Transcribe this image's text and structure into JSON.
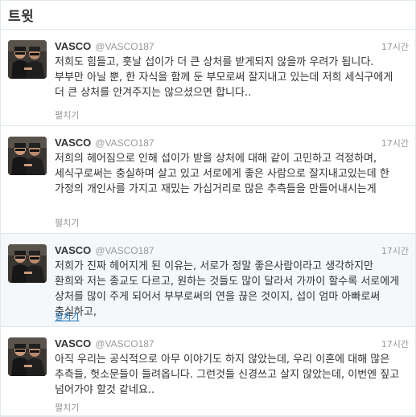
{
  "header": {
    "title": "트윗"
  },
  "tweets": [
    {
      "name": "VASCO",
      "handle": "@VASCO187",
      "time": "17시간",
      "text": "저희도 힘들고, 훗날 섭이가 더 큰 상처를 받게되지 않을까 우려가 됩니다. 부부만 아닐 뿐, 한 자식을 함께 둔 부모로써 잘지내고 있는데 저희 세식구에게 더 큰 상처를 안겨주지는 않으셨으면 합니다..",
      "expand": "펼치기"
    },
    {
      "name": "VASCO",
      "handle": "@VASCO187",
      "time": "17시간",
      "text": "저희의 헤어짐으로 인해 섭이가 받을 상처에 대해 같이 고민하고 걱정하며, 세식구로써는 충실하며 살고 있고 서로에게 좋은 사람으로 잘지내고있는데 한 가정의 개인사를 가지고 재밌는 가십거리로 많은 추측들을 만들어내시는게",
      "expand": "펼치기"
    },
    {
      "name": "VASCO",
      "handle": "@VASCO187",
      "time": "17시간",
      "text": "저희가 진짜 헤어지게 된 이유는, 서로가 정말 좋은사람이라고 생각하지만 환희와 저는 종교도 다르고, 원하는 것들도 많이 달라서 가까이 할수록 서로에게 상처를 많이 주게 되어서 부부로써의 연을 끊은 것이지, 섭이 엄마 아빠로써 충실하고,",
      "expand": "펼치기"
    },
    {
      "name": "VASCO",
      "handle": "@VASCO187",
      "time": "17시간",
      "text": "아직 우리는 공식적으로 아무 이야기도 하지 않았는데, 우리 이혼에 대해 많은 추측들, 헛소문들이 들려옵니다. 그런것들 신경쓰고 살지 않았는데, 이번엔 짚고 넘어가야 할것 같네요..",
      "expand": "펼치기"
    }
  ]
}
